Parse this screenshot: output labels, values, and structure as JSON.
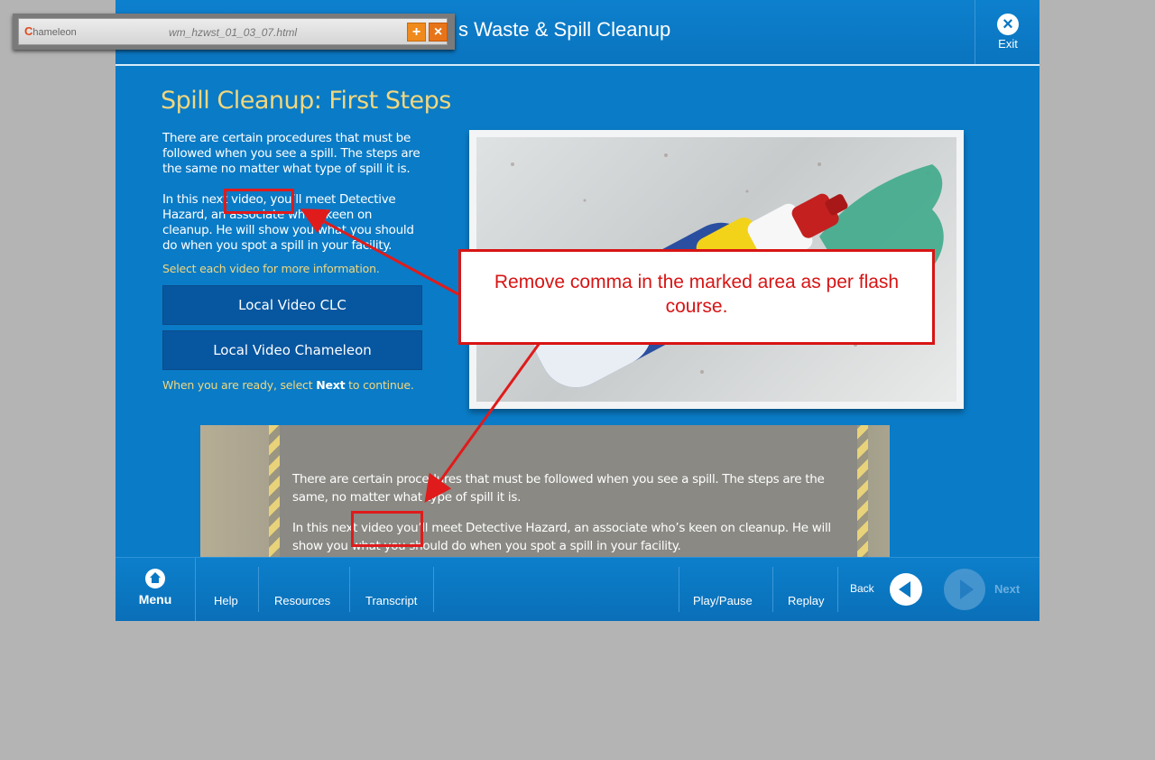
{
  "toolbar": {
    "logo_text": "hameleon",
    "logo_c": "C",
    "file_name": "wm_hzwst_01_03_07.html",
    "plus_label": "+",
    "close_label": "×"
  },
  "header": {
    "title": "s Waste & Spill Cleanup",
    "exit_icon": "×",
    "exit_label": "Exit"
  },
  "content": {
    "page_title": "Spill Cleanup:  First Steps",
    "para1": "There are certain procedures that must be followed when you see a spill.  The steps are the same no matter what type of spill it is.",
    "para2": "In this next video, you’ll meet Detective Hazard, an associate who’s keen on cleanup.  He will show you what you should do when you spot a spill in your facility.",
    "select_note": "Select each video for more information.",
    "buttons": [
      "Local Video CLC",
      "Local Video Chameleon"
    ],
    "ready_pre": "When you are ready, select ",
    "ready_bold": "Next",
    "ready_post": " to continue."
  },
  "transcript": {
    "para1": "There are certain procedures that must be followed when you see a spill.  The steps are the same, no matter what type of spill it is.",
    "para2": "In this next video you’ll meet Detective Hazard, an associate who’s keen on cleanup.  He will show you what you should do when you spot a spill in your facility."
  },
  "footer": {
    "menu_label": "Menu",
    "links": [
      "Help",
      "Resources",
      "Transcript"
    ],
    "play_pause": "Play/Pause",
    "replay": "Replay",
    "back": "Back",
    "next": "Next"
  },
  "annotation": {
    "text": "Remove comma in the marked area as per flash course.",
    "color": "#d81414"
  },
  "colors": {
    "course_blue": "#0a7bc6",
    "title_gold": "#f0d77f",
    "button_blue": "#0756a0"
  }
}
